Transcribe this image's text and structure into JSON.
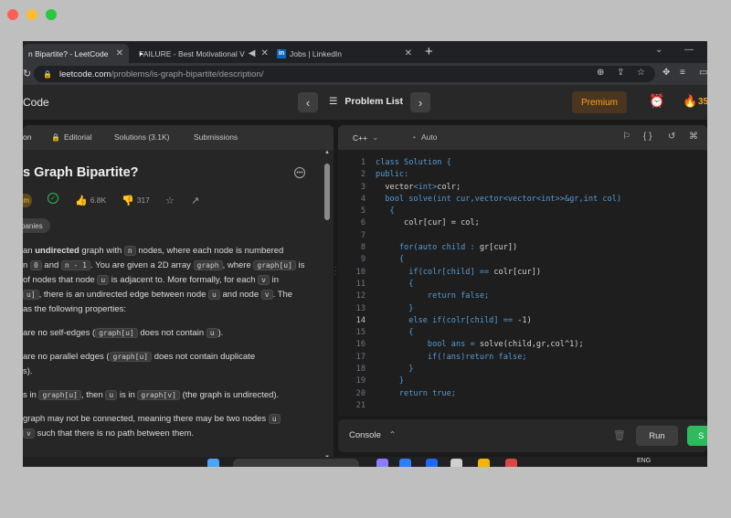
{
  "browser": {
    "tabs": [
      {
        "label": "n Bipartite? - LeetCode"
      },
      {
        "label": "FAILURE - Best Motivational V"
      },
      {
        "label": "Jobs | LinkedIn"
      }
    ],
    "url_host": "leetcode.com",
    "url_path": "/problems/is-graph-bipartite/description/"
  },
  "nav": {
    "logo_text": "Code",
    "problem_list": "Problem List",
    "premium": "Premium",
    "streak": "35"
  },
  "left": {
    "tabs": {
      "description": "on",
      "editorial": "Editorial",
      "solutions": "Solutions (3.1K)",
      "submissions": "Submissions"
    },
    "title": "s Graph Bipartite?",
    "difficulty_fragment": "m",
    "likes": "6.8K",
    "dislikes": "317",
    "companies": "panies",
    "description": [
      [
        {
          "t": " an "
        },
        {
          "t": "undirected",
          "b": true
        },
        {
          "t": " graph with "
        },
        {
          "c": "n"
        },
        {
          "t": " nodes, where each node is numbered"
        }
      ],
      [
        {
          "t": "n "
        },
        {
          "c": "0"
        },
        {
          "t": " and "
        },
        {
          "c": "n - 1"
        },
        {
          "t": ". You are given a 2D array "
        },
        {
          "c": "graph"
        },
        {
          "t": ", where "
        },
        {
          "c": "graph[u]"
        },
        {
          "t": " is"
        }
      ],
      [
        {
          "t": " of nodes that node "
        },
        {
          "c": "u"
        },
        {
          "t": " is adjacent to. More formally, for each "
        },
        {
          "c": "v"
        },
        {
          "t": " in"
        }
      ],
      [
        {
          "c": "u]"
        },
        {
          "t": ", there is an undirected edge between node "
        },
        {
          "c": "u"
        },
        {
          "t": " and node "
        },
        {
          "c": "v"
        },
        {
          "t": ". The"
        }
      ],
      [
        {
          "t": "as the following properties:"
        }
      ],
      [],
      [
        {
          "t": " are no self-edges ("
        },
        {
          "c": "graph[u]"
        },
        {
          "t": " does not contain "
        },
        {
          "c": "u"
        },
        {
          "t": ")."
        }
      ],
      [],
      [
        {
          "t": " are no parallel edges ("
        },
        {
          "c": "graph[u]"
        },
        {
          "t": " does not contain duplicate"
        }
      ],
      [
        {
          "t": "s)."
        }
      ],
      [],
      [
        {
          "t": "s in "
        },
        {
          "c": "graph[u]"
        },
        {
          "t": ", then "
        },
        {
          "c": "u"
        },
        {
          "t": " is in "
        },
        {
          "c": "graph[v]"
        },
        {
          "t": " (the graph is undirected)."
        }
      ],
      [],
      [
        {
          "t": "graph may not be connected, meaning there may be two nodes "
        },
        {
          "c": "u"
        }
      ],
      [
        {
          "c": "v"
        },
        {
          "t": " such that there is no path between them."
        }
      ]
    ]
  },
  "editor": {
    "language": "C++",
    "mode": "Auto",
    "current_line": 14,
    "lines": [
      [
        {
          "k": "class Solution {"
        }
      ],
      [
        {
          "k": "public:"
        }
      ],
      [
        {
          "p": "  vector"
        },
        {
          "k": "<int>"
        },
        {
          "p": "colr;"
        }
      ],
      [
        {
          "k": "  bool solve(int cur,vector<vector<int>>&gr,int col)"
        }
      ],
      [
        {
          "k": "   {"
        }
      ],
      [
        {
          "p": "      colr[cur] = col;"
        }
      ],
      [],
      [
        {
          "k": "     for(auto child : "
        },
        {
          "p": "gr[cur])"
        }
      ],
      [
        {
          "k": "     {"
        }
      ],
      [
        {
          "k": "       if(colr[child] == "
        },
        {
          "p": "colr[cur])"
        }
      ],
      [
        {
          "k": "       {"
        }
      ],
      [
        {
          "k": "           return false;"
        }
      ],
      [
        {
          "k": "       }"
        }
      ],
      [
        {
          "k": "       else if(colr[child] == "
        },
        {
          "p": "-1)"
        }
      ],
      [
        {
          "k": "       {"
        }
      ],
      [
        {
          "k": "           bool ans = "
        },
        {
          "p": "solve(child,gr,col^1);"
        }
      ],
      [
        {
          "k": "           if(!ans)return false;"
        }
      ],
      [
        {
          "k": "       }"
        }
      ],
      [
        {
          "k": "     }"
        }
      ],
      [
        {
          "k": "     return true;"
        }
      ],
      []
    ]
  },
  "console": {
    "label": "Console",
    "run": "Run",
    "submit": "S"
  },
  "taskbar": {
    "lang": "ENG"
  },
  "colors": {
    "accent_orange": "#ffa116",
    "submit_green": "#2cbb5d",
    "keyword_blue": "#569cd6"
  }
}
